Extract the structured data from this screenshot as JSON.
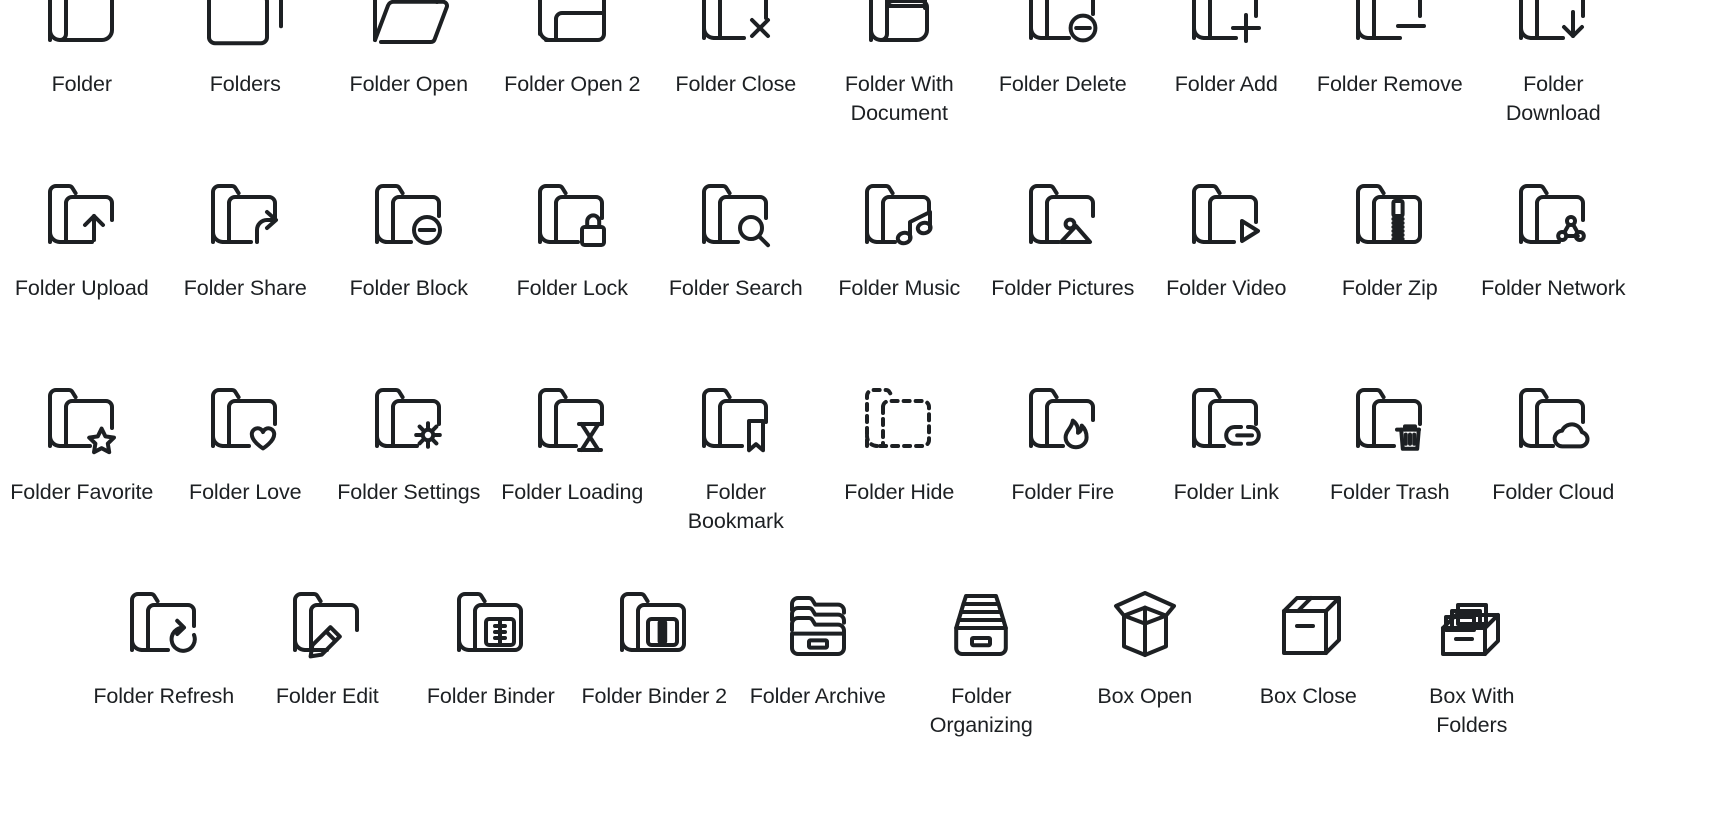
{
  "sheet": {
    "background_color": "#ffffff",
    "stroke_color": "#1d2023",
    "label_color": "#1d2023",
    "columns": 10,
    "rows": 4
  },
  "rows": [
    {
      "row_index": 1,
      "items": [
        {
          "label": "Folder",
          "icon": "folder-icon"
        },
        {
          "label": "Folders",
          "icon": "folders-icon"
        },
        {
          "label": "Folder Open",
          "icon": "folder-open-icon"
        },
        {
          "label": "Folder Open 2",
          "icon": "folder-open-2-icon"
        },
        {
          "label": "Folder Close",
          "icon": "folder-close-icon"
        },
        {
          "label": "Folder With Document",
          "icon": "folder-with-document-icon"
        },
        {
          "label": "Folder Delete",
          "icon": "folder-delete-icon"
        },
        {
          "label": "Folder Add",
          "icon": "folder-add-icon"
        },
        {
          "label": "Folder Remove",
          "icon": "folder-remove-icon"
        },
        {
          "label": "Folder Download",
          "icon": "folder-download-icon"
        }
      ]
    },
    {
      "row_index": 2,
      "items": [
        {
          "label": "Folder Upload",
          "icon": "folder-upload-icon"
        },
        {
          "label": "Folder Share",
          "icon": "folder-share-icon"
        },
        {
          "label": "Folder Block",
          "icon": "folder-block-icon"
        },
        {
          "label": "Folder Lock",
          "icon": "folder-lock-icon"
        },
        {
          "label": "Folder Search",
          "icon": "folder-search-icon"
        },
        {
          "label": "Folder Music",
          "icon": "folder-music-icon"
        },
        {
          "label": "Folder Pictures",
          "icon": "folder-pictures-icon"
        },
        {
          "label": "Folder Video",
          "icon": "folder-video-icon"
        },
        {
          "label": "Folder Zip",
          "icon": "folder-zip-icon"
        },
        {
          "label": "Folder Network",
          "icon": "folder-network-icon"
        }
      ]
    },
    {
      "row_index": 3,
      "items": [
        {
          "label": "Folder Favorite",
          "icon": "folder-favorite-icon"
        },
        {
          "label": "Folder Love",
          "icon": "folder-love-icon"
        },
        {
          "label": "Folder Settings",
          "icon": "folder-settings-icon"
        },
        {
          "label": "Folder Loading",
          "icon": "folder-loading-icon"
        },
        {
          "label": "Folder Bookmark",
          "icon": "folder-bookmark-icon"
        },
        {
          "label": "Folder Hide",
          "icon": "folder-hide-icon"
        },
        {
          "label": "Folder Fire",
          "icon": "folder-fire-icon"
        },
        {
          "label": "Folder Link",
          "icon": "folder-link-icon"
        },
        {
          "label": "Folder Trash",
          "icon": "folder-trash-icon"
        },
        {
          "label": "Folder Cloud",
          "icon": "folder-cloud-icon"
        }
      ]
    },
    {
      "row_index": 4,
      "items": [
        {
          "label": "Folder Refresh",
          "icon": "folder-refresh-icon"
        },
        {
          "label": "Folder Edit",
          "icon": "folder-edit-icon"
        },
        {
          "label": "Folder Binder",
          "icon": "folder-binder-icon"
        },
        {
          "label": "Folder Binder 2",
          "icon": "folder-binder-2-icon"
        },
        {
          "label": "Folder Archive",
          "icon": "folder-archive-icon"
        },
        {
          "label": "Folder Organizing",
          "icon": "folder-organizing-icon"
        },
        {
          "label": "Box Open",
          "icon": "box-open-icon"
        },
        {
          "label": "Box Close",
          "icon": "box-close-icon"
        },
        {
          "label": "Box With Folders",
          "icon": "box-with-folders-icon"
        }
      ]
    }
  ]
}
